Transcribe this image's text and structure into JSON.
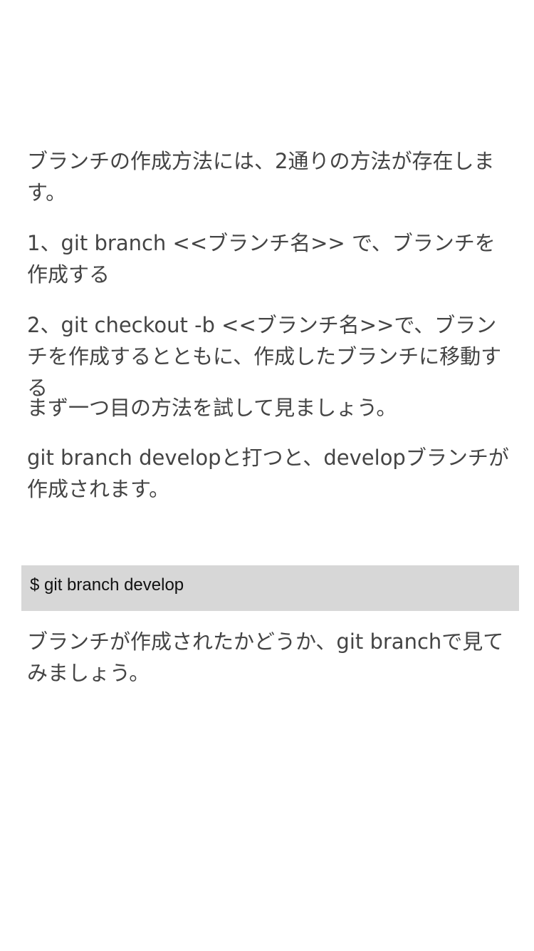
{
  "article": {
    "paragraphs": [
      "ブランチの作成方法には、2通りの方法が存在します。",
      "1、git branch <<ブランチ名>> で、ブランチを作成する",
      "2、git checkout -b <<ブランチ名>>で、ブランチを作成するとともに、作成したブランチに移動する",
      "まず一つ目の方法を試して見ましょう。",
      "git branch developと打つと、developブランチが作成されます。"
    ],
    "code": "$ git branch develop",
    "after_code": "ブランチが作成されたかどうか、git branchで見てみましょう。"
  }
}
